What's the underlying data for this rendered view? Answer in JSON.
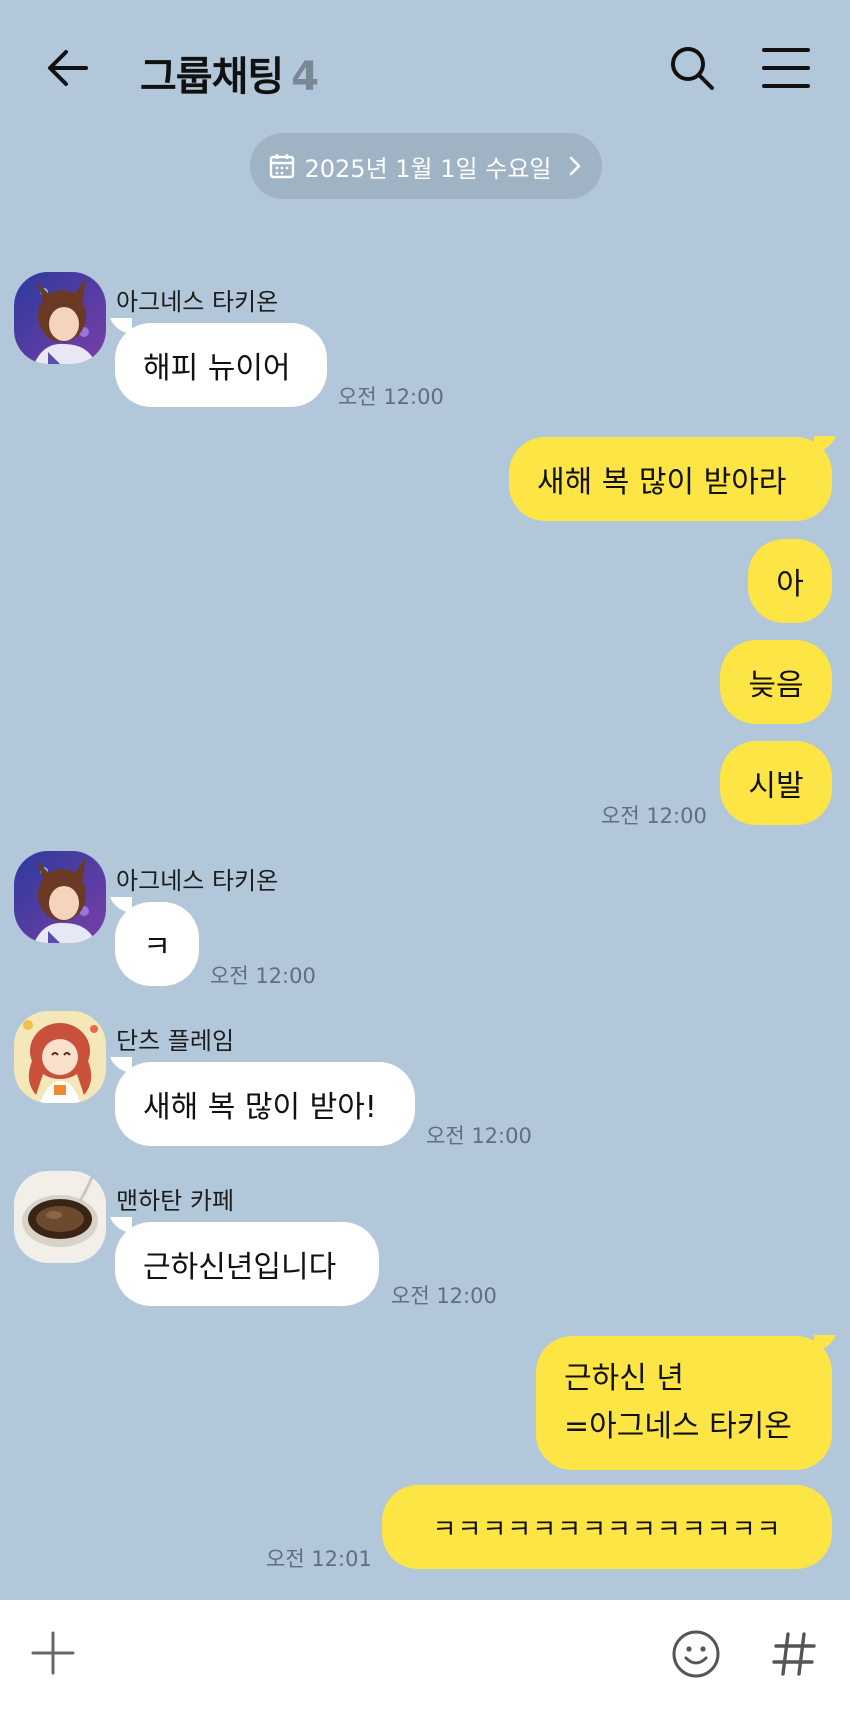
{
  "header": {
    "title": "그룹채팅",
    "member_count": "4"
  },
  "date_pill": {
    "label": "2025년 1월 1일 수요일"
  },
  "messages": [
    {
      "sender": "아그네스 타키온",
      "text": "해피 뉴이어",
      "time": "오전 12:00"
    },
    {
      "text": "새해 복 많이 받아라"
    },
    {
      "text": "아"
    },
    {
      "text": "늦음"
    },
    {
      "text": "시발",
      "time": "오전 12:00"
    },
    {
      "sender": "아그네스 타키온",
      "text": "ㅋ",
      "time": "오전 12:00"
    },
    {
      "sender": "단츠 플레임",
      "text": "새해 복 많이 받아!",
      "time": "오전 12:00"
    },
    {
      "sender": "맨하탄 카페",
      "text": "근하신년입니다",
      "time": "오전 12:00"
    },
    {
      "line1": "근하신 년",
      "line2": "=아그네스 타키온"
    },
    {
      "text": "ㅋㅋㅋㅋㅋㅋㅋㅋㅋㅋㅋㅋㅋㅋ",
      "time": "오전 12:01"
    }
  ],
  "icons": {
    "back": "arrow-left-icon",
    "search": "search-icon",
    "menu": "hamburger-menu-icon",
    "calendar": "calendar-icon",
    "plus": "plus-icon",
    "emoji": "smiley-icon",
    "hash": "hashtag-icon"
  },
  "colors": {
    "background": "#b2c7da",
    "outgoing_bubble": "#fde545",
    "incoming_bubble": "#ffffff",
    "date_pill": "#9fb3c5"
  }
}
